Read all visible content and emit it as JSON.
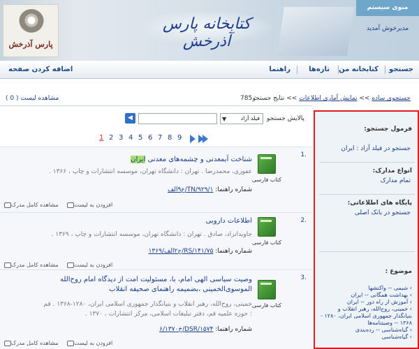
{
  "header": {
    "logo_text": "پارس آذرخش",
    "banner_title": "کتابخانه پارس آذرخش",
    "system_menu": "منوی سیستم",
    "greeting": "مدیرخوش آمدید"
  },
  "nav": {
    "search": "جستجو",
    "my_library": "کتابخانه من",
    "news": "تازه‌ها",
    "help": "راهنما",
    "add_homepage": "اضافه کردن صفحه"
  },
  "breadcrumb": {
    "simple_search": "جستجوی ساده",
    "stats": "نمایش آماری اطلاعات",
    "results": "نتایج جستجو",
    "separator": ">>",
    "count": "785 :",
    "view_list": "مشاهده لیست ( 0 )"
  },
  "refine": {
    "label": "پالایش جستجو",
    "field": "فیلد آزاد",
    "input_value": "",
    "go": "◀"
  },
  "pager": {
    "pages": [
      "1",
      "2",
      "3",
      "4",
      "5",
      "6",
      "7",
      "8",
      "9"
    ],
    "active": "1"
  },
  "results": [
    {
      "num": "1.",
      "type": "کتاب فارسی",
      "title_pre": "شناخت آبمعدنی و چشمه‌های معدنی ",
      "title_hl": "ایران",
      "meta": "عفوری، محمدرضا . تهران : دانشگاه تهران، موسسه انتشارات و چاپ ، ۱۳۶۶ .",
      "call_label": "شماره راهنما:",
      "call_no": "TN/۹۲۹/۱/ع۹الف",
      "add_list": "افزودن به لیست",
      "view_full": "مشاهده کامل مدرک"
    },
    {
      "num": "2.",
      "type": "کتاب فارسی",
      "title": "اطلاعات دارویی",
      "meta": "جاویدانزاد، صادق . تهران : دانشگاه تهران، موسسه انتشارات و چاپ ، ۱۳۶۹ .",
      "call_label": "شماره راهنما:",
      "call_no": "RS/۱۴۱/۷۵/ج۲الف/۱۳۶۹",
      "add_list": "افزودن به لیست",
      "view_full": "مشاهده کامل مدرک"
    },
    {
      "num": "3.",
      "type": "کتاب فارسی",
      "title_line1": "وصیت سیاسی الهی امام، با، مسئولیت امت از دیدگاه امام روح‌الله",
      "title_line2": "الموسوی‌الخمینی ،بضمیمه راهنمای صحیفه انقلاب",
      "meta_line1": "خمینی، روح‌الله، رهبر انقلاب و بنیانگذار جمهوری اسلامی ایران، ۱۲۸۰-۱۳۶۸ . قم",
      "meta_line2": ": حوزه علمیه قم، دفتر تبلیغات اسلامی، مرکز انتشارات ، ۱۳۷۰ .",
      "call_label": "شماره راهنما:",
      "call_no": "DSR/۱۵۷۴/خ۶/۱۳۷۰",
      "add_list": "افزودن به لیست",
      "view_full": "مشاهده کامل مدرک"
    }
  ],
  "side": {
    "formula_h": "فرمول جستجو:",
    "formula_t": "جستجو در فیلد آزاد : ایران",
    "doctypes_h": "انواع مدارک:",
    "doctypes_t": "تمام مدارک",
    "db_h": "پایگاه های اطلاعاتی:",
    "db_t": "جستجو در بانک اصلی",
    "topic_h": "موضوع :",
    "topics": [
      "› شیمی -- واکنشها",
      "› بهداشت همگانی -- ایران",
      "› آموزش از راه دور -- ایران",
      "› خمینی، روح‌الله، رهبر انقلاب و بنیانگذار جمهوری اسلامی ایران، ۱۲۸۰ - ۱۳۶۸ -- وصیتنامه‌ها",
      "› گیاه‌شناسی -- رده‌بندی",
      "› گیاه‌شناسی"
    ]
  }
}
